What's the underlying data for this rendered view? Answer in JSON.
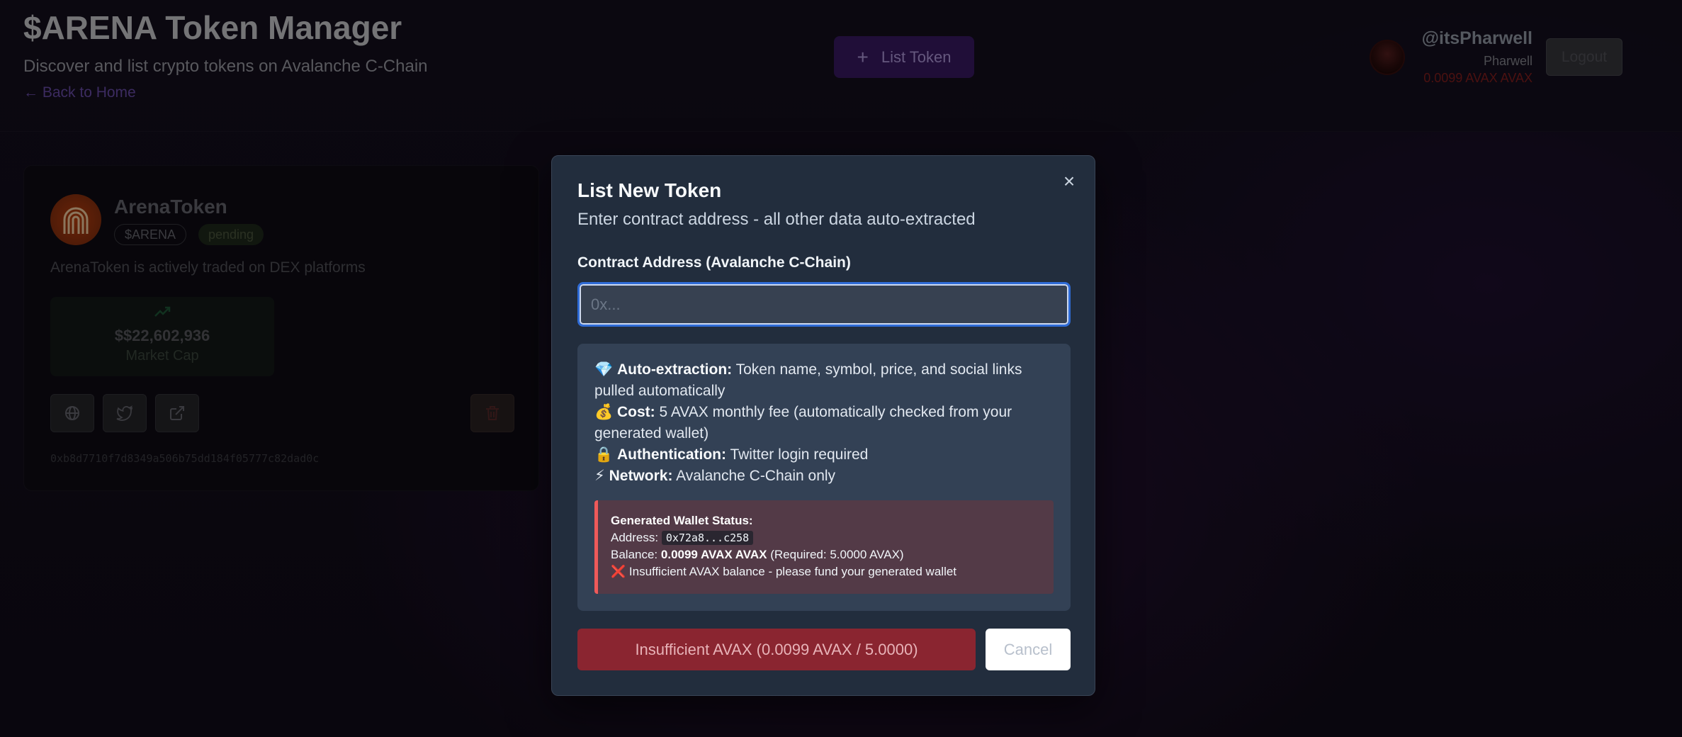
{
  "header": {
    "title": "$ARENA Token Manager",
    "subtitle": "Discover and list crypto tokens on Avalanche C-Chain",
    "back_link": "← Back to Home",
    "list_token_label": "List Token",
    "user": {
      "handle": "@itsPharwell",
      "name": "Pharwell",
      "balance": "0.0099 AVAX AVAX"
    },
    "logout_label": "Logout"
  },
  "token_card": {
    "name": "ArenaToken",
    "symbol": "$ARENA",
    "status": "pending",
    "description": "ArenaToken is actively traded on DEX platforms",
    "market_cap_value": "$$22,602,936",
    "market_cap_label": "Market Cap",
    "contract": "0xb8d7710f7d8349a506b75dd184f05777c82dad0c",
    "icons": [
      "globe-icon",
      "twitter-icon",
      "external-link-icon",
      "trash-icon"
    ]
  },
  "modal": {
    "title": "List New Token",
    "subtitle": "Enter contract address - all other data auto-extracted",
    "field_label": "Contract Address (Avalanche C-Chain)",
    "input_value": "",
    "input_placeholder": "0x...",
    "info": [
      {
        "emoji": "💎",
        "label": "Auto-extraction:",
        "text": " Token name, symbol, price, and social links pulled automatically"
      },
      {
        "emoji": "💰",
        "label": "Cost:",
        "text": " 5 AVAX monthly fee (automatically checked from your generated wallet)"
      },
      {
        "emoji": "🔒",
        "label": "Authentication:",
        "text": " Twitter login required"
      },
      {
        "emoji": "⚡",
        "label": "Network:",
        "text": " Avalanche C-Chain only"
      }
    ],
    "wallet": {
      "heading": "Generated Wallet Status:",
      "address_label": "Address: ",
      "address": "0x72a8...c258",
      "balance_label": "Balance: ",
      "balance": "0.0099 AVAX AVAX",
      "required": " (Required: 5.0000 AVAX)",
      "warning_icon": "❌",
      "warning": " Insufficient AVAX balance - please fund your generated wallet"
    },
    "submit_label": "Insufficient AVAX (0.0099 AVAX / 5.0000)",
    "cancel_label": "Cancel",
    "close_label": "×"
  },
  "colors": {
    "accent": "#2f6bd6",
    "danger": "#8a2530",
    "warning_border": "#ef5a5a"
  }
}
